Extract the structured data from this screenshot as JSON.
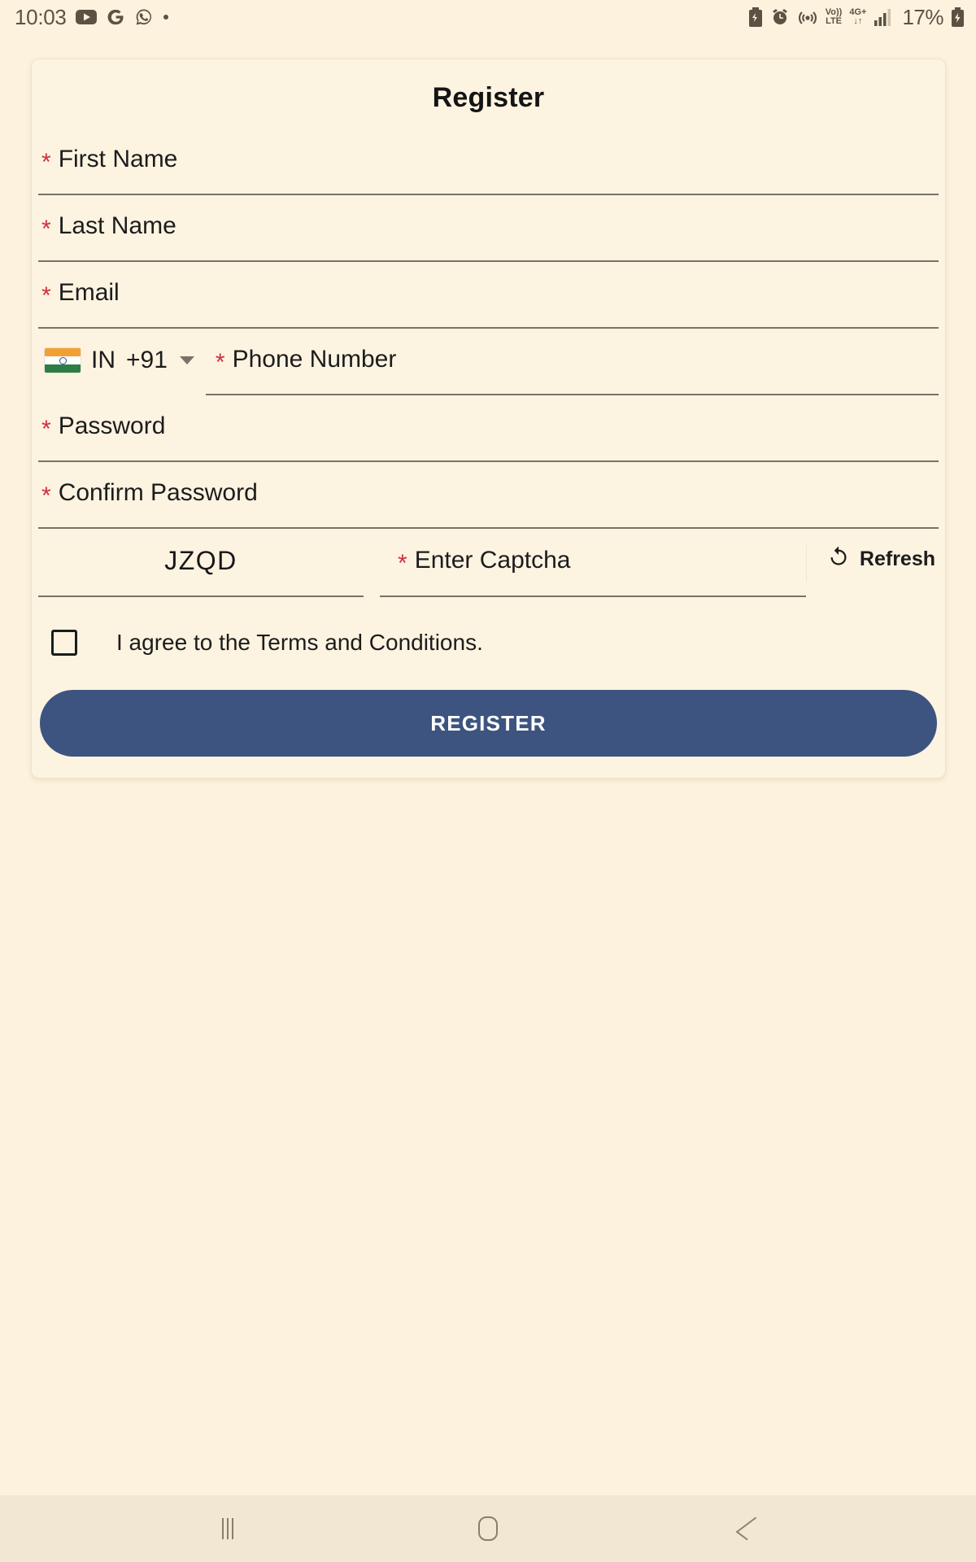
{
  "status_bar": {
    "time": "10:03",
    "left_icons": [
      "youtube-icon",
      "google-icon",
      "whatsapp-icon",
      "dot-indicator"
    ],
    "battery_percent": "17%",
    "volte_top": "Vo))",
    "volte_bottom": "LTE",
    "network_top": "4G+",
    "network_bottom": "↓↑",
    "right_icons": [
      "battery-saver-icon",
      "alarm-icon",
      "hotspot-icon",
      "volte-icon",
      "network-4gplus-icon",
      "signal-bars-icon",
      "charging-battery-icon"
    ]
  },
  "card": {
    "title": "Register",
    "required_mark": "*",
    "fields": [
      {
        "label": "First Name",
        "required": true,
        "value": "",
        "placeholder": "First Name"
      },
      {
        "label": "Last Name",
        "required": true,
        "value": "",
        "placeholder": "Last Name"
      },
      {
        "label": "Email",
        "required": true,
        "value": "",
        "placeholder": "Email"
      }
    ],
    "phone": {
      "country_code": "IN",
      "dial_code": "+91",
      "flag": "india-flag",
      "label": "Phone Number",
      "required": true,
      "value": "",
      "placeholder": "Phone Number"
    },
    "password_fields": [
      {
        "label": "Password",
        "required": true,
        "value": "",
        "placeholder": "Password"
      },
      {
        "label": "Confirm Password",
        "required": true,
        "value": "",
        "placeholder": "Confirm Password"
      }
    ],
    "captcha": {
      "code": "JZQD",
      "input_label": "Enter Captcha",
      "required": true,
      "value": "",
      "placeholder": "Enter Captcha",
      "refresh_label": "Refresh",
      "refresh_icon": "refresh-icon"
    },
    "terms": {
      "checked": false,
      "text": "I agree to the Terms and Conditions."
    },
    "submit_label": "REGISTER"
  },
  "nav_bar": {
    "recents_label": "Recents",
    "home_label": "Home",
    "back_label": "Back"
  },
  "colors": {
    "background": "#fdf2dd",
    "card": "#fdf3e1",
    "accent": "#3d5480",
    "required": "#cf3040",
    "underline": "#7a7266",
    "nav_bar": "#f2e7d2"
  }
}
